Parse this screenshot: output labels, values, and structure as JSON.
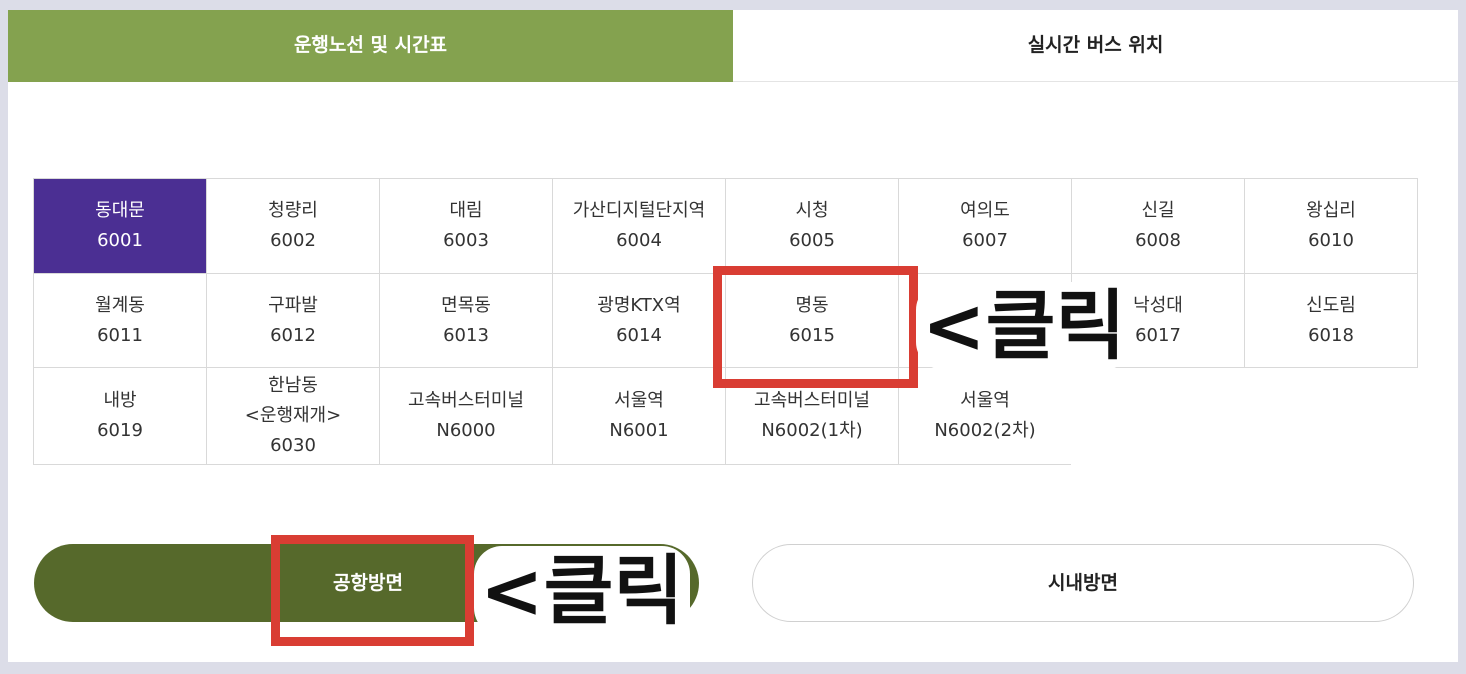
{
  "tabs": [
    {
      "label": "운행노선 및 시간표",
      "active": true
    },
    {
      "label": "실시간 버스 위치",
      "active": false
    }
  ],
  "routes": [
    {
      "name": "동대문",
      "code": "6001",
      "selected": true
    },
    {
      "name": "청량리",
      "code": "6002"
    },
    {
      "name": "대림",
      "code": "6003"
    },
    {
      "name": "가산디지털단지역",
      "code": "6004"
    },
    {
      "name": "시청",
      "code": "6005"
    },
    {
      "name": "여의도",
      "code": "6007"
    },
    {
      "name": "신길",
      "code": "6008"
    },
    {
      "name": "왕십리",
      "code": "6010"
    },
    {
      "name": "월계동",
      "code": "6011"
    },
    {
      "name": "구파발",
      "code": "6012"
    },
    {
      "name": "면목동",
      "code": "6013"
    },
    {
      "name": "광명KTX역",
      "code": "6014"
    },
    {
      "name": "명동",
      "code": "6015"
    },
    {
      "name": "",
      "code": ""
    },
    {
      "name": "낙성대",
      "code": "6017"
    },
    {
      "name": "신도림",
      "code": "6018"
    },
    {
      "name": "내방",
      "code": "6019"
    },
    {
      "name": "한남동",
      "note": "<운행재개>",
      "code": "6030"
    },
    {
      "name": "고속버스터미널",
      "code": "N6000"
    },
    {
      "name": "서울역",
      "code": "N6001"
    },
    {
      "name": "고속버스터미널",
      "code": "N6002(1차)"
    },
    {
      "name": "서울역",
      "code": "N6002(2차)"
    }
  ],
  "direction_buttons": {
    "airport": "공항방면",
    "city": "시내방면"
  },
  "annotations": {
    "click_label": "<클릭",
    "highlight_color": "#d93d33"
  },
  "colors": {
    "tab_active": "#84a24f",
    "selected_route": "#4b2f93",
    "airport_button": "#56692b"
  }
}
